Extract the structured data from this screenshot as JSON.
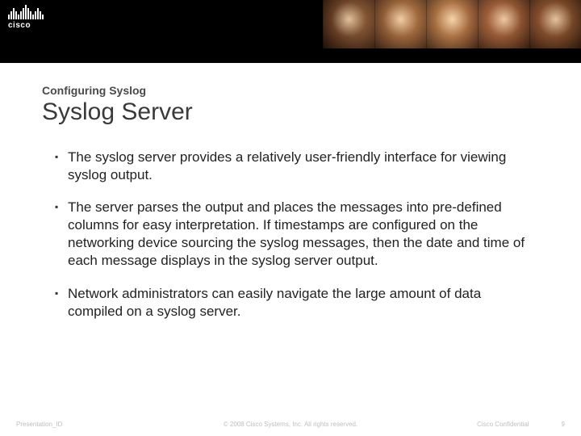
{
  "logo": {
    "brand": "cisco"
  },
  "header": {
    "kicker": "Configuring Syslog",
    "title": "Syslog Server"
  },
  "bullets": [
    "The syslog server provides a relatively user-friendly interface for viewing syslog output.",
    "The server parses the output and places the messages into pre-defined columns for easy interpretation. If timestamps are configured on the networking device sourcing the syslog messages, then the date and time of each message displays in the syslog server output.",
    "Network administrators can easily navigate the large amount of data compiled on a syslog server."
  ],
  "footer": {
    "left": "Presentation_ID",
    "center": "© 2008 Cisco Systems, Inc. All rights reserved.",
    "confidential": "Cisco Confidential",
    "page": "9"
  }
}
